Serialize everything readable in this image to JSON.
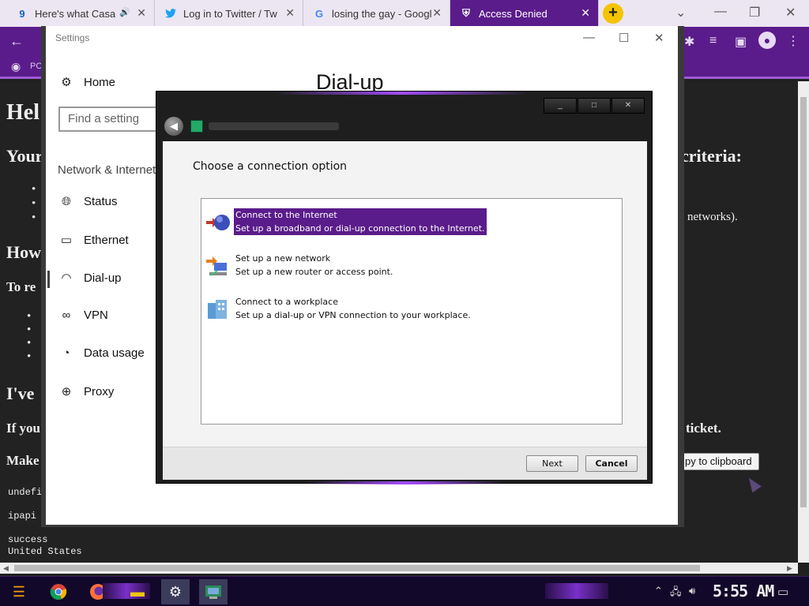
{
  "browser": {
    "tabs": [
      {
        "title": "Here's what Casa",
        "favicon": "9",
        "fav_color": "#1565c0"
      },
      {
        "title": "Log in to Twitter / Tw",
        "favicon": "bird",
        "fav_color": "#1da1f2"
      },
      {
        "title": "losing the gay - Googl",
        "favicon": "G",
        "fav_color": "#4285f4"
      },
      {
        "title": "Access Denied",
        "favicon": "shield",
        "fav_color": "#ffffff"
      }
    ],
    "bookmark_label": "PC",
    "accent_color": "#5a1c8a"
  },
  "webpage": {
    "h1": "Hel",
    "line_your": "Your",
    "line_criteria": "criteria:",
    "bullets_top": [
      "•",
      "•",
      "•"
    ],
    "networks_text": "networks).",
    "h2_how": "How",
    "line_to_re": "To re",
    "bullets_mid": [
      "•",
      "•",
      "•",
      "•"
    ],
    "h2_ive": "I've",
    "line_if_you": "If you",
    "line_ticket": "ticket.",
    "line_make": "Make",
    "copy_button": "py to clipboard",
    "mono_lines": [
      "undefi",
      "ipapi",
      "success",
      "United States"
    ]
  },
  "settings": {
    "window_title": "Settings",
    "home": "Home",
    "search_placeholder": "Find a setting",
    "section": "Network & Internet",
    "nav": [
      {
        "label": "Status",
        "icon": "globe-status-icon"
      },
      {
        "label": "Ethernet",
        "icon": "ethernet-icon"
      },
      {
        "label": "Dial-up",
        "icon": "dialup-icon"
      },
      {
        "label": "VPN",
        "icon": "vpn-icon"
      },
      {
        "label": "Data usage",
        "icon": "data-usage-icon"
      },
      {
        "label": "Proxy",
        "icon": "globe-icon"
      }
    ],
    "page_title": "Dial-up"
  },
  "wizard": {
    "heading": "Choose a connection option",
    "options": [
      {
        "title": "Connect to the Internet",
        "desc": "Set up a broadband or dial-up connection to the Internet.",
        "icon": "globe-connect-icon",
        "selected": true
      },
      {
        "title": "Set up a new network",
        "desc": "Set up a new router or access point.",
        "icon": "router-icon",
        "selected": false
      },
      {
        "title": "Connect to a workplace",
        "desc": "Set up a dial-up or VPN connection to your workplace.",
        "icon": "workplace-icon",
        "selected": false
      }
    ],
    "next_label": "Next",
    "cancel_label": "Cancel",
    "selection_color": "#5a1c8a"
  },
  "taskbar": {
    "clock": "5:55 AM",
    "apps": [
      "start",
      "chrome",
      "firefox",
      "file-explorer",
      "settings",
      "network-wizard"
    ]
  }
}
